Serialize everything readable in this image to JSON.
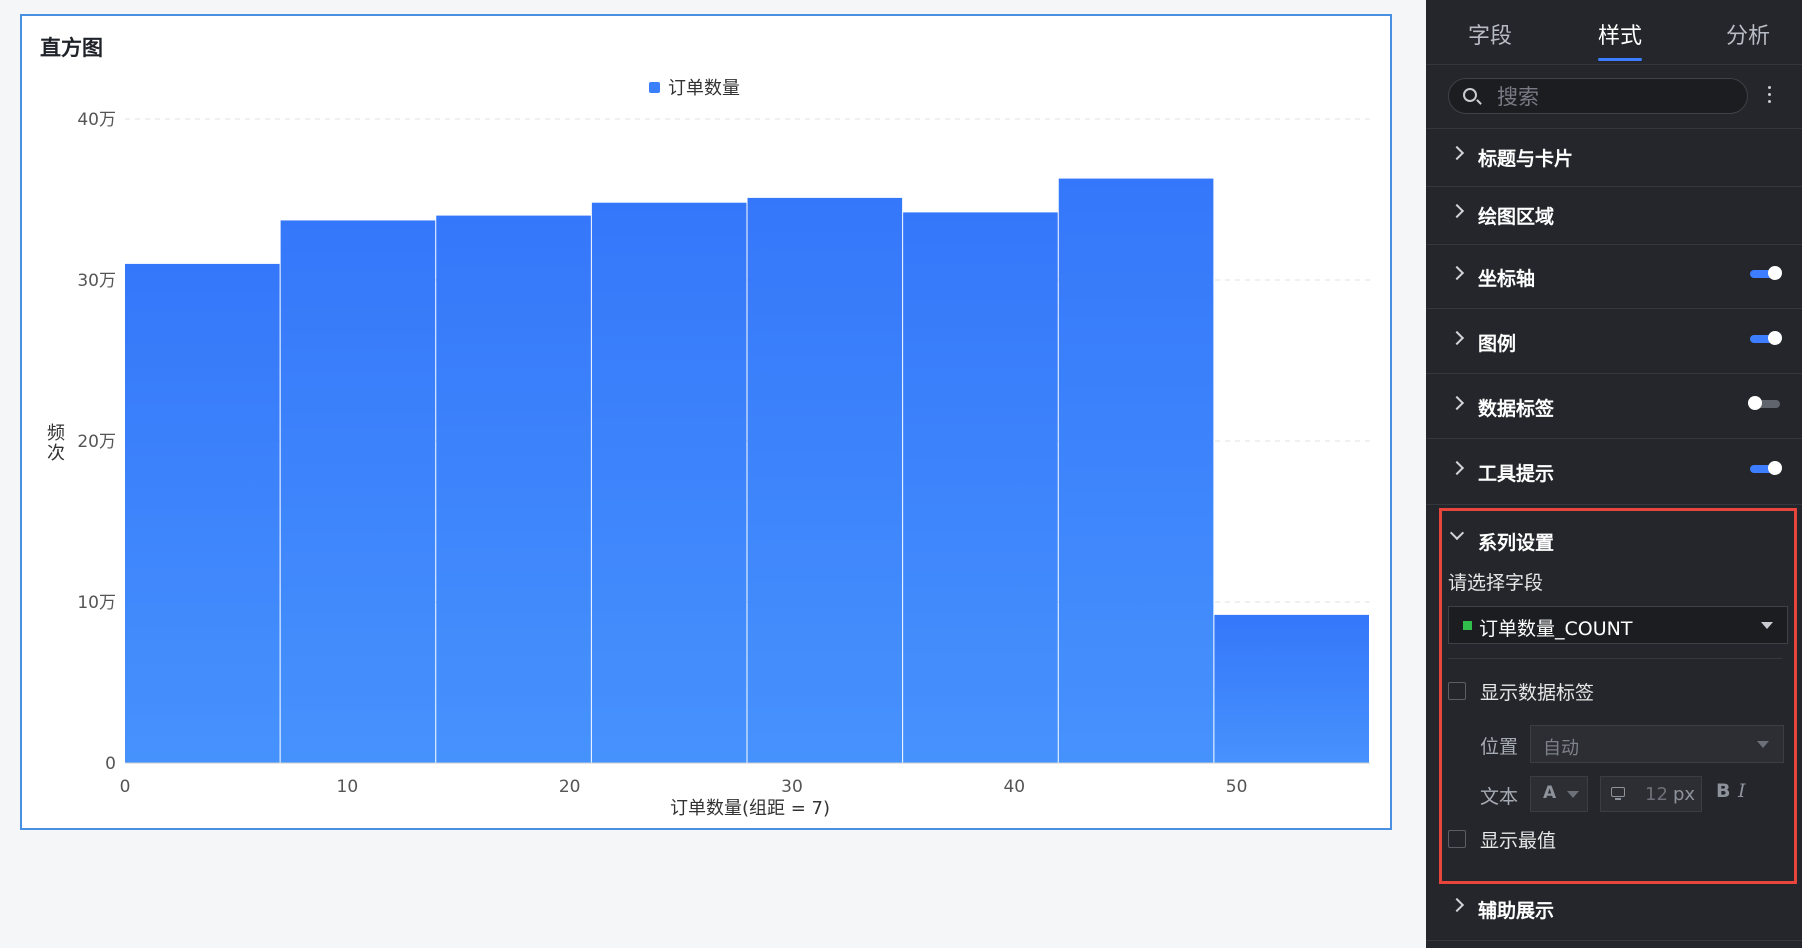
{
  "chart_card": {
    "title": "直方图"
  },
  "chart_data": {
    "type": "bar",
    "legend": {
      "label": "订单数量",
      "placement": "top-center"
    },
    "color": "#3a7ffc",
    "bins": [
      {
        "x0": 0,
        "x1": 7,
        "value": 310000
      },
      {
        "x0": 7,
        "x1": 14,
        "value": 337000
      },
      {
        "x0": 14,
        "x1": 21,
        "value": 340000
      },
      {
        "x0": 21,
        "x1": 28,
        "value": 348000
      },
      {
        "x0": 28,
        "x1": 35,
        "value": 351000
      },
      {
        "x0": 35,
        "x1": 42,
        "value": 342000
      },
      {
        "x0": 42,
        "x1": 49,
        "value": 363000
      },
      {
        "x0": 49,
        "x1": 56,
        "value": 92000
      }
    ],
    "xlim": [
      0,
      56
    ],
    "ylim": [
      0,
      400000
    ],
    "x_ticks": [
      0,
      10,
      20,
      30,
      40,
      50
    ],
    "y_ticks": [
      {
        "value": 0,
        "label": "0"
      },
      {
        "value": 100000,
        "label": "10万"
      },
      {
        "value": 200000,
        "label": "20万"
      },
      {
        "value": 300000,
        "label": "30万"
      },
      {
        "value": 400000,
        "label": "40万"
      }
    ],
    "xlabel": "订单数量(组距 = 7)",
    "ylabel": "频次",
    "grid": "horizontal-dashed"
  },
  "panel": {
    "tabs": [
      "字段",
      "样式",
      "分析"
    ],
    "active_tab": "样式",
    "search_placeholder": "搜索",
    "sections": {
      "title_card": "标题与卡片",
      "plot_area": "绘图区域",
      "axis": "坐标轴",
      "legend": "图例",
      "data_labels": "数据标签",
      "tooltip": "工具提示",
      "series": "系列设置",
      "aux": "辅助展示"
    },
    "toggles": {
      "axis": "on",
      "legend": "on",
      "data_labels": "off",
      "tooltip": "on"
    },
    "series": {
      "select_field_label": "请选择字段",
      "selected_field": "订单数量_COUNT",
      "show_labels": "显示数据标签",
      "position_label": "位置",
      "position_value": "自动",
      "text_label": "文本",
      "font_color_glyph": "A",
      "font_size": "12",
      "font_unit": "px",
      "bold_glyph": "B",
      "italic_glyph": "I",
      "show_extreme": "显示最值"
    },
    "highlight_color": "#e8453c"
  }
}
